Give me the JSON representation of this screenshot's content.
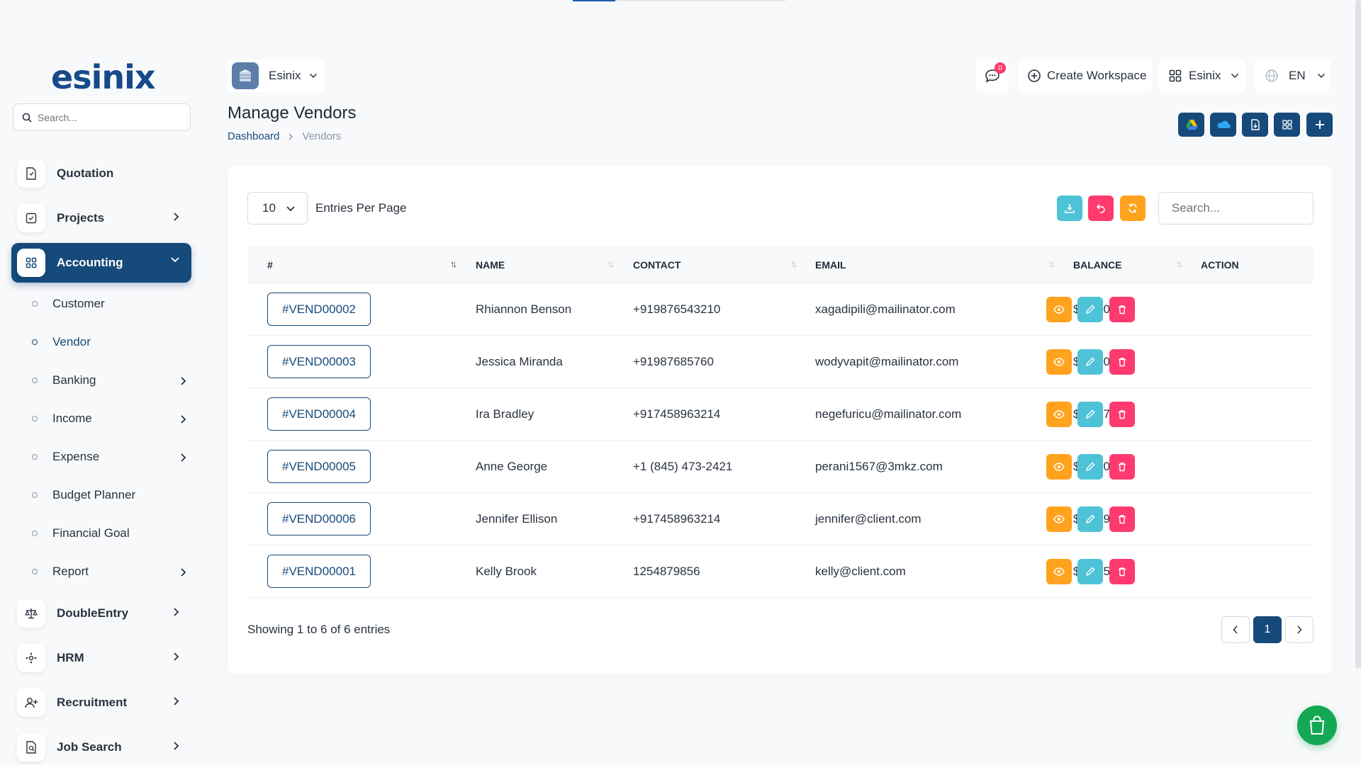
{
  "app": {
    "logo": "esinix",
    "sidebar_search_placeholder": "Search..."
  },
  "sidebar": {
    "main_items": [
      {
        "label": "Quotation",
        "icon": "quotation-icon"
      },
      {
        "label": "Projects",
        "icon": "projects-icon",
        "has_submenu": true
      },
      {
        "label": "Accounting",
        "icon": "accounting-icon",
        "has_submenu": true,
        "active": true
      },
      {
        "label": "DoubleEntry",
        "icon": "scale-icon",
        "has_submenu": true
      },
      {
        "label": "HRM",
        "icon": "hrm-icon",
        "has_submenu": true
      },
      {
        "label": "Recruitment",
        "icon": "recruitment-icon",
        "has_submenu": true
      },
      {
        "label": "Job Search",
        "icon": "job-search-icon",
        "has_submenu": true
      }
    ],
    "sub_items": [
      {
        "label": "Customer"
      },
      {
        "label": "Vendor",
        "active": true
      },
      {
        "label": "Banking",
        "has_submenu": true
      },
      {
        "label": "Income",
        "has_submenu": true
      },
      {
        "label": "Expense",
        "has_submenu": true
      },
      {
        "label": "Budget Planner"
      },
      {
        "label": "Financial Goal"
      },
      {
        "label": "Report",
        "has_submenu": true
      }
    ]
  },
  "header": {
    "workspace": "Esinix",
    "chat_badge": "0",
    "create_workspace": "Create Workspace",
    "workspace_menu": "Esinix",
    "language": "EN",
    "page_title": "Manage Vendors",
    "breadcrumb": {
      "home": "Dashboard",
      "current": "Vendors"
    }
  },
  "toolbar": {
    "entries_value": "10",
    "entries_label": "Entries Per Page",
    "search_placeholder": "Search..."
  },
  "table": {
    "columns": [
      "#",
      "NAME",
      "CONTACT",
      "EMAIL",
      "BALANCE",
      "ACTION"
    ],
    "rows": [
      {
        "id": "#VEND00002",
        "name": "Rhiannon Benson",
        "contact": "+919876543210",
        "email": "xagadipili@mailinator.com",
        "balance": "$143,060.0"
      },
      {
        "id": "#VEND00003",
        "name": "Jessica Miranda",
        "contact": "+91987685760",
        "email": "wodyvapit@mailinator.com",
        "balance": "$1,200.0"
      },
      {
        "id": "#VEND00004",
        "name": "Ira Bradley",
        "contact": "+917458963214",
        "email": "negefuricu@mailinator.com",
        "balance": "$42,473.8"
      },
      {
        "id": "#VEND00005",
        "name": "Anne George",
        "contact": "+1 (845) 473-2421",
        "email": "perani1567@3mkz.com",
        "balance": "$12,100.0"
      },
      {
        "id": "#VEND00006",
        "name": "Jennifer Ellison",
        "contact": "+917458963214",
        "email": "jennifer@client.com",
        "balance": "$19,590.0"
      },
      {
        "id": "#VEND00001",
        "name": "Kelly Brook",
        "contact": "1254879856",
        "email": "kelly@client.com",
        "balance": "$509,500.0"
      }
    ]
  },
  "footer": {
    "showing": "Showing 1 to 6 of 6 entries",
    "current_page": "1"
  },
  "colors": {
    "primary": "#164a7a",
    "view": "#ffa21d",
    "edit": "#4ec3d8",
    "delete": "#ff3a6e",
    "cart": "#14a854"
  }
}
